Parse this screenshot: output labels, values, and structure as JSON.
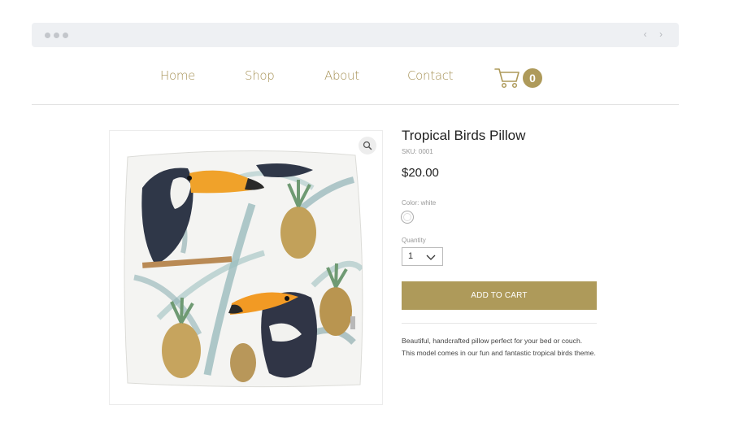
{
  "nav": {
    "home": "Home",
    "shop": "Shop",
    "about": "About",
    "contact": "Contact",
    "cart_count": "0"
  },
  "product": {
    "title": "Tropical Birds Pillow",
    "sku": "SKU: 0001",
    "price": "$20.00",
    "color_label": "Color: white",
    "quantity_label": "Quantity",
    "quantity_value": "1",
    "add_to_cart": "ADD TO CART",
    "description_line1": "Beautiful, handcrafted pillow perfect for your bed or couch.",
    "description_line2": "This model comes in our fun and fantastic tropical birds theme."
  },
  "colors": {
    "accent": "#ae9a5a",
    "nav_text": "#a79358"
  },
  "icons": {
    "cart": "cart-icon",
    "zoom": "magnifier-icon",
    "dropdown": "chevron-down-icon"
  }
}
